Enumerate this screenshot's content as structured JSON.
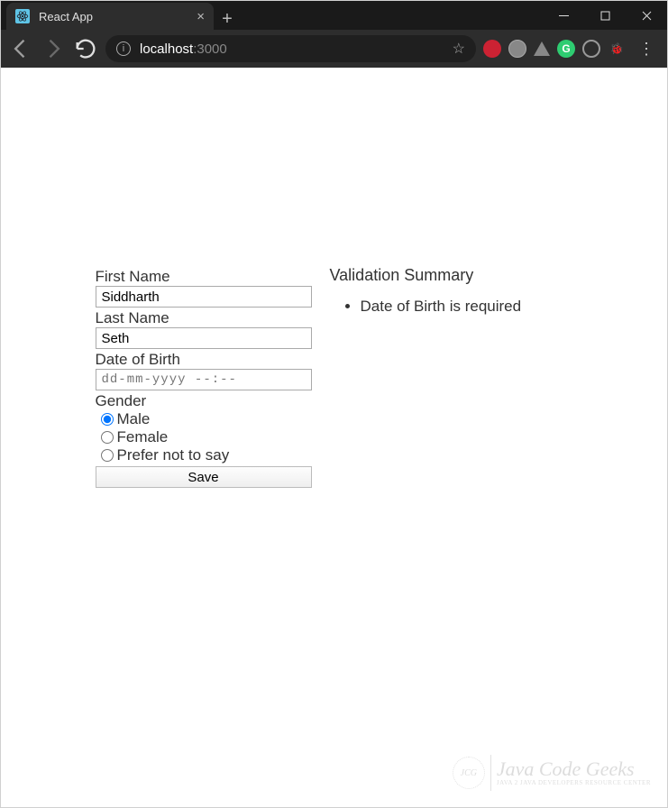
{
  "browser": {
    "tab_title": "React App",
    "url_host": "localhost",
    "url_rest": ":3000",
    "newtab_glyph": "+",
    "close_glyph": "×",
    "star_glyph": "☆",
    "menu_glyph": "⋮"
  },
  "form": {
    "first_name_label": "First Name",
    "first_name_value": "Siddharth",
    "last_name_label": "Last Name",
    "last_name_value": "Seth",
    "dob_label": "Date of Birth",
    "dob_placeholder": "dd-mm-yyyy --:--",
    "gender_label": "Gender",
    "gender_options": {
      "male": "Male",
      "female": "Female",
      "prefer_not": "Prefer not to say"
    },
    "gender_selected": "male",
    "save_label": "Save"
  },
  "validation": {
    "heading": "Validation Summary",
    "errors": [
      "Date of Birth is required"
    ]
  },
  "watermark": {
    "logo_text": "JCG",
    "main": "Java Code Geeks",
    "sub": "JAVA 2 JAVA DEVELOPERS RESOURCE CENTER"
  }
}
